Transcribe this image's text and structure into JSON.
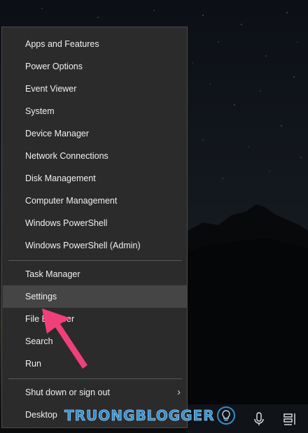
{
  "menu": {
    "groups": [
      [
        "Apps and Features",
        "Power Options",
        "Event Viewer",
        "System",
        "Device Manager",
        "Network Connections",
        "Disk Management",
        "Computer Management",
        "Windows PowerShell",
        "Windows PowerShell (Admin)"
      ],
      [
        "Task Manager",
        "Settings",
        "File Explorer",
        "Search",
        "Run"
      ],
      [
        "Shut down or sign out",
        "Desktop"
      ]
    ],
    "selected_item": "Settings",
    "submenu_indicator": "›"
  },
  "watermark": {
    "text": "TRUONGBLOGGER",
    "color": "#2f8fd0"
  },
  "taskbar": {
    "icons": [
      "microphone-icon",
      "notifications-icon"
    ]
  },
  "annotation": {
    "arrow_color": "#f0407a"
  },
  "colors": {
    "menu_bg": "#2b2b2b",
    "menu_text": "#f0f0f0",
    "selected_bg": "#454545"
  }
}
